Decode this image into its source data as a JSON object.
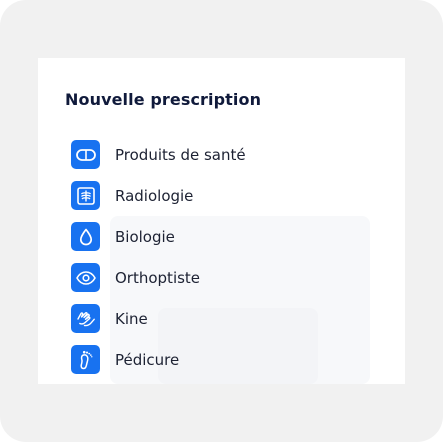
{
  "panel": {
    "title": "Nouvelle prescription"
  },
  "menu": {
    "items": [
      {
        "label": "Produits de santé",
        "icon": "pill-icon"
      },
      {
        "label": "Radiologie",
        "icon": "xray-icon"
      },
      {
        "label": "Biologie",
        "icon": "drop-icon"
      },
      {
        "label": "Orthoptiste",
        "icon": "eye-icon"
      },
      {
        "label": "Kine",
        "icon": "hands-icon"
      },
      {
        "label": "Pédicure",
        "icon": "foot-icon"
      }
    ]
  },
  "colors": {
    "accent": "#1872f0",
    "title": "#101a3b",
    "text": "#1d2233",
    "frame": "#f1f1f1"
  }
}
